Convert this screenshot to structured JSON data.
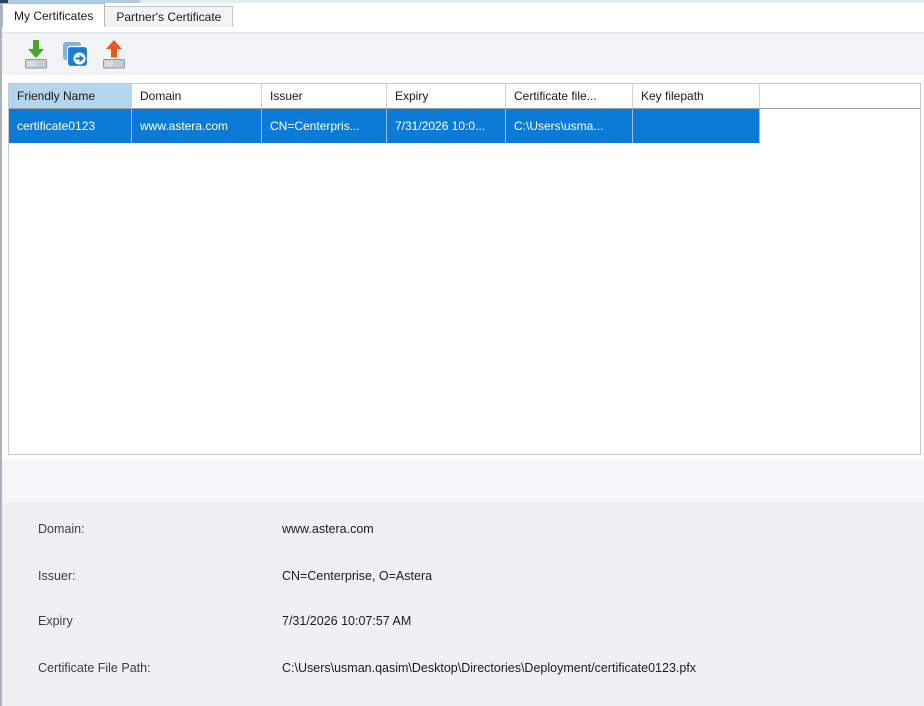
{
  "tabs": [
    {
      "label": "My Certificates",
      "active": true
    },
    {
      "label": "Partner's Certificate",
      "active": false
    }
  ],
  "toolbar": {
    "buttons": [
      {
        "name": "import-certificate",
        "icon": "download-certificate-icon"
      },
      {
        "name": "copy-certificate",
        "icon": "copy-certificate-icon"
      },
      {
        "name": "export-certificate",
        "icon": "upload-certificate-icon"
      }
    ]
  },
  "table": {
    "columns": [
      "Friendly Name",
      "Domain",
      "Issuer",
      "Expiry",
      "Certificate file...",
      "Key filepath"
    ],
    "sorted_column": "Friendly Name",
    "rows": [
      {
        "selected": true,
        "cells": [
          "certificate0123",
          "www.astera.com",
          "CN=Centerpris...",
          "7/31/2026 10:0...",
          "C:\\Users\\usma...",
          ""
        ]
      }
    ]
  },
  "details": {
    "rows": [
      {
        "label": "Domain:",
        "value": "www.astera.com"
      },
      {
        "label": "Issuer:",
        "value": "CN=Centerprise, O=Astera"
      },
      {
        "label": "Expiry",
        "value": "7/31/2026 10:07:57 AM"
      },
      {
        "label": "Certificate File Path:",
        "value": "C:\\Users\\usman.qasim\\Desktop\\Directories\\Deployment/certificate0123.pfx"
      }
    ]
  },
  "colors": {
    "selection_blue": "#0b7bd7",
    "sorted_header_highlight": "#b5d5ec",
    "toolbar_bg": "#f2f3f5",
    "details_panel_bg": "#eef0f1",
    "icon_green": "#43a82a",
    "icon_blue": "#1a7fd4",
    "icon_orange": "#ea5a1e"
  }
}
